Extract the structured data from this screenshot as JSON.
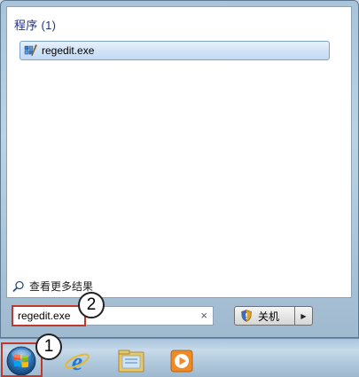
{
  "start_menu": {
    "group_header": "程序 (1)",
    "results": [
      {
        "label": "regedit.exe",
        "icon": "registry-editor-icon"
      }
    ],
    "see_more": "查看更多结果"
  },
  "search": {
    "value": "regedit.exe",
    "clear_glyph": "×"
  },
  "shutdown": {
    "label": "关机",
    "arrow": "▶"
  },
  "callouts": {
    "one": "1",
    "two": "2"
  },
  "taskbar": {
    "pinned": [
      "internet-explorer-icon",
      "file-explorer-icon",
      "media-player-icon"
    ]
  },
  "colors": {
    "header_text": "#1e3287",
    "highlight_red": "#c0392b",
    "selection_border": "#7da2ce"
  }
}
